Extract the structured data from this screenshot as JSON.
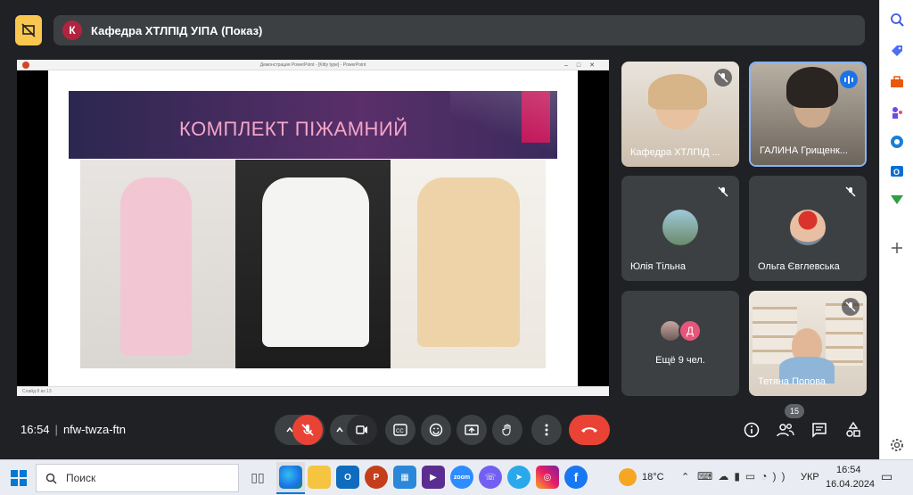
{
  "meeting": {
    "avatar_letter": "К",
    "title": "Кафедра ХТЛПІД УІПА (Показ)",
    "time": "16:54",
    "separator": "|",
    "code": "nfw-twza-ftn",
    "participants_badge": "15"
  },
  "presentation": {
    "window_title": "Демонстрация PowerPoint - [Kitty type] - PowerPoint",
    "slide_title": "КОМПЛЕКТ ПІЖАМНИЙ",
    "status_text": "Слайд 8 из 13"
  },
  "participants": [
    {
      "name": "Кафедра ХТЛПІД ...",
      "mic": "off"
    },
    {
      "name": "ГАЛИНА Грищенк...",
      "mic": "speaking"
    },
    {
      "name": "Юлія Тільна",
      "mic": "off"
    },
    {
      "name": "Ольга Євглевська",
      "mic": "off"
    },
    {
      "name": "Ещё 9 чел.",
      "avatar_letter": "Д"
    },
    {
      "name": "Тетяна Попова",
      "mic": "off"
    }
  ],
  "controls": [
    "chevron-up",
    "mic-off",
    "chevron-up",
    "camera",
    "captions",
    "emoji",
    "present",
    "raise-hand",
    "more",
    "end-call"
  ],
  "right_controls": [
    "info",
    "people",
    "chat",
    "activities"
  ],
  "taskbar": {
    "search_label": "Поиск",
    "weather": "18°C",
    "language": "УКР",
    "time": "16:54",
    "date": "16.04.2024"
  },
  "colors": {
    "meet_bg": "#202124",
    "tile_bg": "#3c4043",
    "end_call": "#ea4335",
    "presenting_yellow": "#f9c74f",
    "accent_blue": "#1a73e8"
  }
}
